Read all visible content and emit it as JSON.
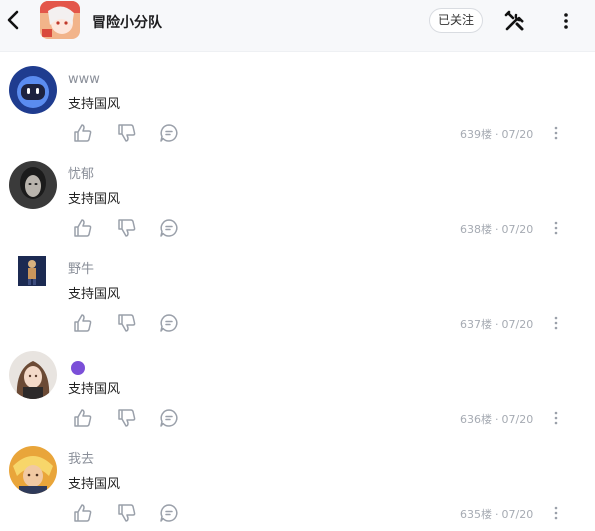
{
  "header": {
    "group_name": "冒险小分队",
    "follow_label": "已关注"
  },
  "comments": [
    {
      "username": "www",
      "content": "支持国风",
      "floor": "639楼",
      "date": "07/20"
    },
    {
      "username": "忧郁",
      "content": "支持国风",
      "floor": "638楼",
      "date": "07/20"
    },
    {
      "username": "野牛",
      "content": "支持国风",
      "floor": "637楼",
      "date": "07/20"
    },
    {
      "username": "",
      "content": "支持国风",
      "floor": "636楼",
      "date": "07/20"
    },
    {
      "username": "我去",
      "content": "支持国风",
      "floor": "635楼",
      "date": "07/20"
    }
  ],
  "colors": {
    "header_bg": "#f7f8fa",
    "muted_text": "#8a8f99",
    "icon_gray": "#9aa0aa",
    "badge_purple": "#7b4fd8"
  }
}
